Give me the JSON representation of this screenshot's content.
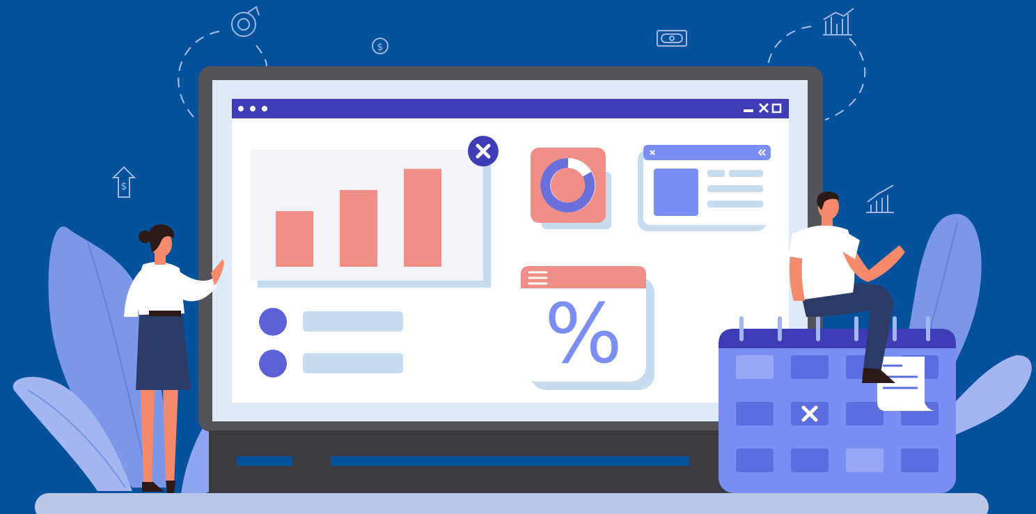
{
  "scene": {
    "background_color": "#06519c",
    "window": {
      "titlebar_color": "#3f3db5",
      "control_icons": [
        "dot-icon",
        "dot-icon",
        "dot-icon",
        "minimize-icon",
        "close-icon",
        "maximize-icon"
      ]
    },
    "bar_chart": {
      "type": "bar",
      "values": [
        42,
        58,
        74
      ],
      "bar_color": "#ef8f87",
      "badge_icon": "close-circle-icon"
    },
    "donut_card": {
      "filled_fraction": 0.7,
      "icon": "donut-chart-icon"
    },
    "percent_card": {
      "symbol": "%"
    },
    "list_panel": {
      "bullet_count": 2
    },
    "calendar": {
      "marked_icon": "close-icon"
    },
    "decorative_icons": [
      "donut-chart-icon",
      "dollar-coin-icon",
      "banknote-icon",
      "bar-growth-icon",
      "dollar-up-icon"
    ]
  }
}
